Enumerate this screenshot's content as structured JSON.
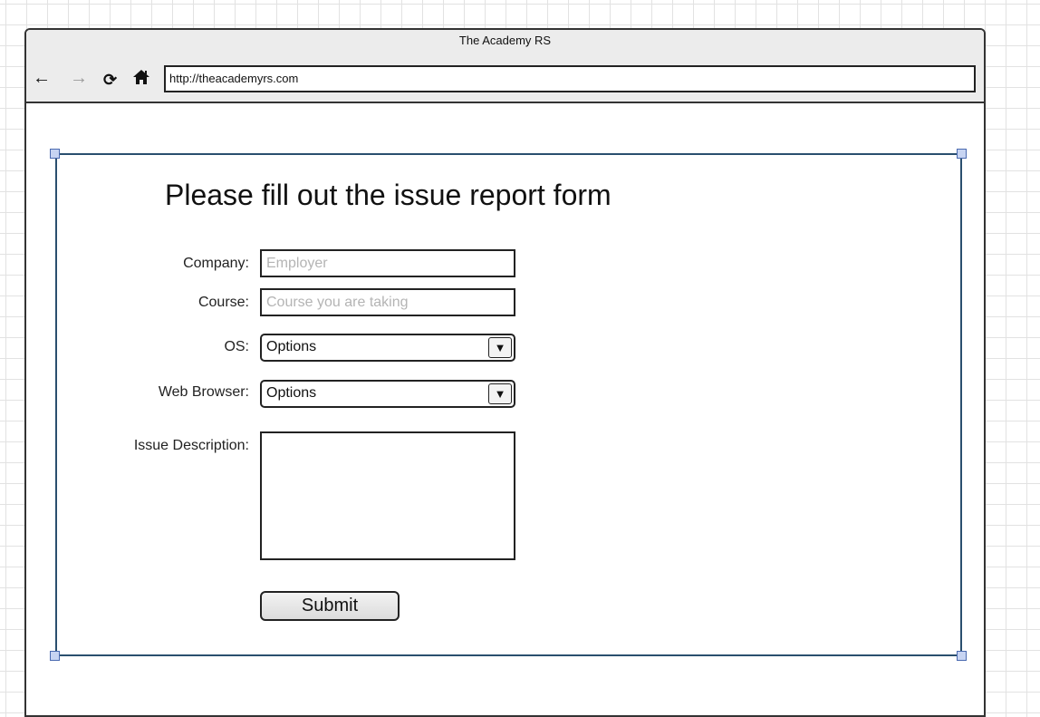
{
  "browser": {
    "window_title": "The Academy RS",
    "url": "http://theacademyrs.com",
    "icons": {
      "back": "arrow-left-icon",
      "forward": "arrow-right-icon",
      "reload": "reload-icon",
      "home": "home-icon"
    }
  },
  "form": {
    "heading": "Please fill out the issue report form",
    "company": {
      "label": "Company:",
      "placeholder": "Employer",
      "value": ""
    },
    "course": {
      "label": "Course:",
      "placeholder": "Course you are taking",
      "value": ""
    },
    "os": {
      "label": "OS:",
      "selected": "Options"
    },
    "web_browser": {
      "label": "Web Browser:",
      "selected": "Options"
    },
    "issue_description": {
      "label": "Issue Description:",
      "value": ""
    },
    "submit_label": "Submit"
  },
  "colors": {
    "frame_border": "#2a4f6e",
    "handle_fill": "#c7d4f2",
    "handle_border": "#4a6ab0",
    "placeholder_text": "#b4b4b4",
    "forward_disabled": "#9a9a9a"
  }
}
